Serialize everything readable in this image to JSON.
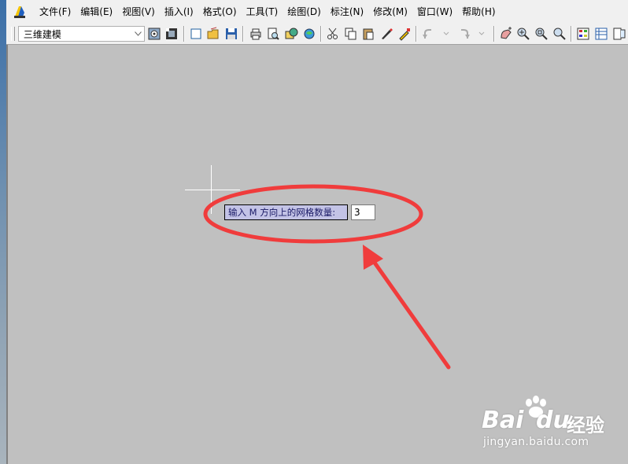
{
  "menubar": {
    "items": [
      "文件(F)",
      "编辑(E)",
      "视图(V)",
      "插入(I)",
      "格式(O)",
      "工具(T)",
      "绘图(D)",
      "标注(N)",
      "修改(M)",
      "窗口(W)",
      "帮助(H)"
    ]
  },
  "toolbar": {
    "workspace_value": "三维建模"
  },
  "command": {
    "prompt": "输入 M 方向上的网格数量:",
    "value": "3"
  },
  "watermark": {
    "brand_part1": "Bai",
    "brand_part2": "du",
    "brand_cn": "经验",
    "url": "jingyan.baidu.com"
  },
  "colors": {
    "canvas": "#c0c0c0",
    "annotation": "#f03c3c",
    "prompt_bg": "#c3c3e6"
  }
}
